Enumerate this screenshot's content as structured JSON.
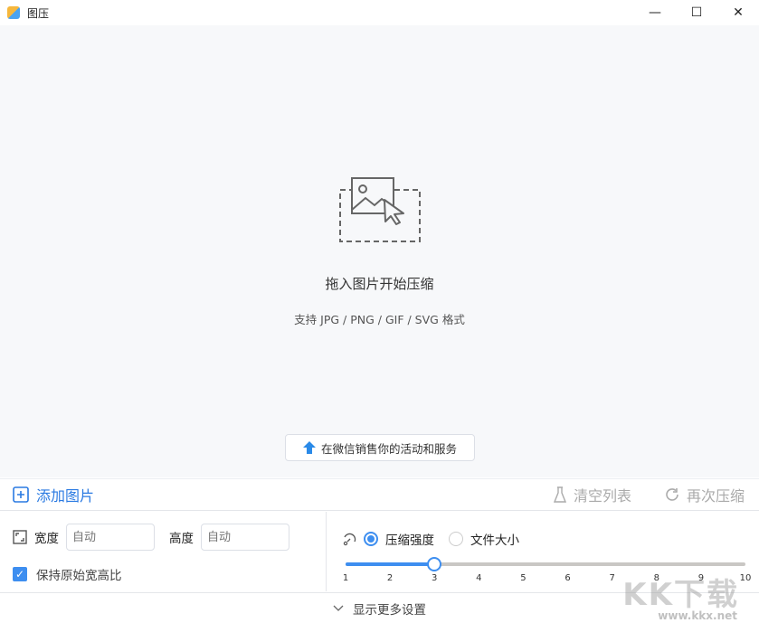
{
  "window": {
    "title": "图压",
    "minimize": "—",
    "maximize": "☐",
    "close": "✕"
  },
  "drop": {
    "title": "拖入图片开始压缩",
    "subtitle": "支持 JPG / PNG / GIF / SVG 格式",
    "promo": "在微信销售你的活动和服务"
  },
  "toolbar": {
    "add": "添加图片",
    "clear": "清空列表",
    "recompress": "再次压缩"
  },
  "size": {
    "width_label": "宽度",
    "width_placeholder": "自动",
    "height_label": "高度",
    "height_placeholder": "自动",
    "keep_ratio": "保持原始宽高比",
    "keep_ratio_checked": true
  },
  "compress": {
    "mode_strength": "压缩强度",
    "mode_filesize": "文件大小",
    "selected": "压缩强度",
    "slider_value": 3,
    "slider_min": 1,
    "slider_max": 10,
    "ticks": [
      "1",
      "2",
      "3",
      "4",
      "5",
      "6",
      "7",
      "8",
      "9",
      "10"
    ]
  },
  "footer": {
    "more": "显示更多设置"
  },
  "watermark": {
    "text": "KK下载",
    "url": "www.kkx.net"
  }
}
